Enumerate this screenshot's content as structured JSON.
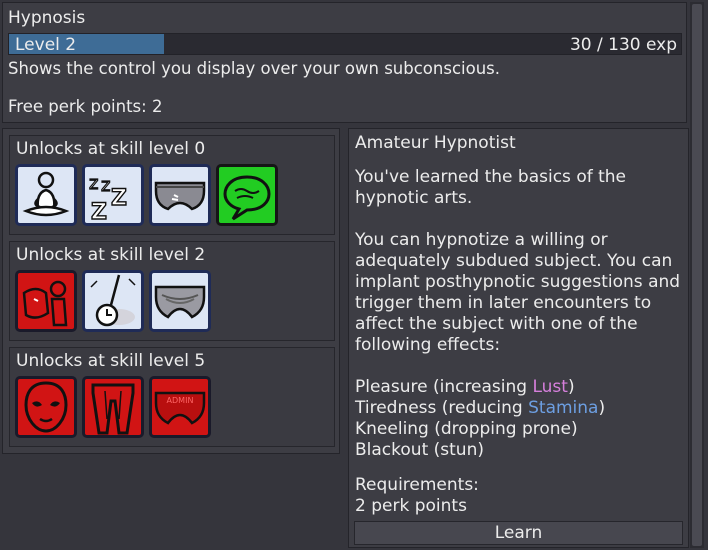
{
  "skill": {
    "name": "Hypnosis",
    "level_label": "Level 2",
    "exp_text": "30 / 130 exp",
    "progress_fraction": 0.23,
    "description": "Shows the control you display over your own subconscious.",
    "free_perk_points": "Free perk points: 2"
  },
  "tiers": [
    {
      "label": "Unlocks at skill level 0",
      "perks": [
        "meditation-icon",
        "sleep-zzz-icon",
        "underwear-icon",
        "speech-bubble-icon"
      ]
    },
    {
      "label": "Unlocks at skill level 2",
      "perks": [
        "figure-icon",
        "pocket-watch-icon",
        "underwear-icon"
      ]
    },
    {
      "label": "Unlocks at skill level 5",
      "perks": [
        "mask-icon",
        "legs-icon",
        "underwear-icon"
      ]
    }
  ],
  "detail": {
    "title": "Amateur Hypnotist",
    "para1_line1": "You've learned the basics of the",
    "para1_line2": "hypnotic arts.",
    "para2_line1": "You can hypnotize a willing or",
    "para2_line2": "adequately subdued subject. You can",
    "para2_line3": "implant posthypnotic suggestions and",
    "para2_line4": "trigger them in later encounters to",
    "para2_line5": "affect the subject with one of the",
    "para2_line6": "following effects:",
    "effect1_prefix": "Pleasure (increasing ",
    "effect1_stat": "Lust",
    "effect1_suffix": ")",
    "effect2_prefix": "Tiredness (reducing ",
    "effect2_stat": "Stamina",
    "effect2_suffix": ")",
    "effect3": "Kneeling (dropping prone)",
    "effect4": "Blackout (stun)",
    "requirements_label": "Requirements:",
    "requirements_value": "2 perk points",
    "learn_label": "Learn"
  },
  "perk_badge_text": "ADMIN",
  "colors": {
    "lust": "#d67fdc",
    "stamina": "#6d9fe2",
    "progress": "#3e6c96",
    "perk_red": "#d11414",
    "perk_green": "#22cc22"
  }
}
